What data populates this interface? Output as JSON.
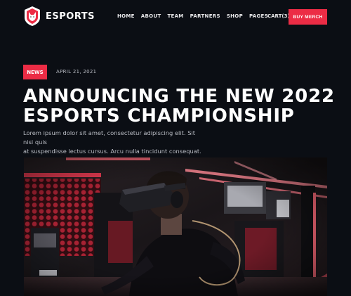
{
  "brand": {
    "name": "ESPORTS",
    "logo_icon": "wolf-shield-logo-icon",
    "accent": "#ec2c45"
  },
  "nav": {
    "items": [
      "HOME",
      "ABOUT",
      "TEAM",
      "PARTNERS",
      "SHOP",
      "PAGES"
    ],
    "cart_label": "CART(3)",
    "cta_label": "BUY MERCH"
  },
  "article": {
    "category": "NEWS",
    "date": "APRIL 21, 2021",
    "title_lines": [
      "ANNOUNCING THE NEW 2022",
      "ESPORTS CHAMPIONSHIP"
    ],
    "lead_lines": [
      "Lorem ipsum dolor sit amet, consectetur adipiscing elit. Sit nisi quis",
      "at suspendisse lectus cursus. Arcu nulla tincidunt consequat."
    ]
  },
  "hero_image": {
    "subject": "person-wearing-vr-headset-in-gaming-arena"
  },
  "colors": {
    "background": "#0b0e14",
    "accent": "#ec2c45"
  }
}
